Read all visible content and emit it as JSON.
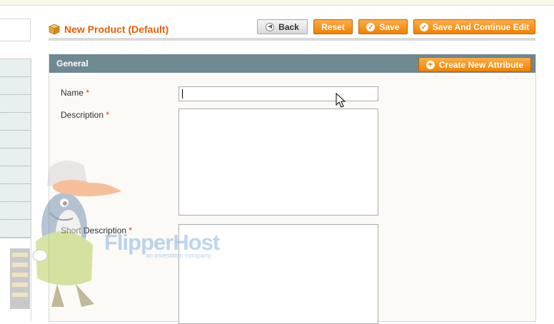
{
  "header": {
    "title": "New Product (Default)",
    "buttons": {
      "back": "Back",
      "reset": "Reset",
      "save": "Save",
      "save_continue": "Save And Continue Edit"
    }
  },
  "fieldset": {
    "title": "General",
    "create_attribute": "Create New Attribute",
    "fields": {
      "name_label": "Name",
      "description_label": "Description",
      "short_description_label": "Short Description",
      "required_mark": "*",
      "name_value": "",
      "description_value": "",
      "short_description_value": ""
    }
  },
  "watermark": {
    "logo": "FlipperHost",
    "tagline": "an investition company",
    "cap_text": "FLIPPER HOST"
  },
  "colors": {
    "accent": "#eb5e00",
    "button": "#f18200",
    "fieldset_header": "#6f8992",
    "required": "#eb340a"
  }
}
